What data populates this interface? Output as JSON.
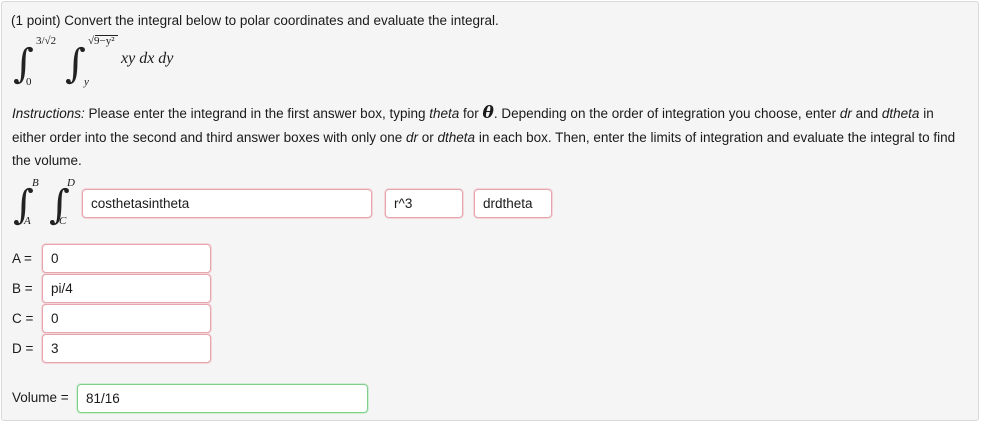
{
  "problem": {
    "header": "(1 point) Convert the integral below to polar coordinates and evaluate the integral.",
    "integral": {
      "outer_upper": "3/√2",
      "outer_lower": "0",
      "inner_upper": "√9−y²",
      "inner_lower": "y",
      "integrand": "xy dx dy"
    }
  },
  "instructions": {
    "label": "Instructions:",
    "part1": " Please enter the integrand in the first answer box, typing ",
    "theta_word": "theta",
    "part2": " for ",
    "theta_symbol": "θ",
    "part3": ". Depending on the order of integration you choose, enter ",
    "dr": "dr",
    "part4": " and ",
    "dtheta": "dtheta",
    "part5": " in either order into the second and third answer boxes with only one ",
    "dr2": "dr",
    "part6": " or ",
    "dtheta2": "dtheta",
    "part7": " in each box. Then, enter the limits of integration and evaluate the integral to find the volume."
  },
  "polar_integral": {
    "outer_upper": "B",
    "outer_lower": "A",
    "inner_upper": "D",
    "inner_lower": "C"
  },
  "answers": {
    "integrand": "costhetasintheta",
    "differential1": "r^3",
    "differential2": "drdtheta",
    "limits": [
      {
        "label": "A =",
        "value": "0"
      },
      {
        "label": "B =",
        "value": "pi/4"
      },
      {
        "label": "C =",
        "value": "0"
      },
      {
        "label": "D =",
        "value": "3"
      }
    ],
    "volume_label": "Volume =",
    "volume": "81/16"
  },
  "colors": {
    "incorrect_border": "#e6a6ae",
    "correct_border": "#7fcf8a",
    "panel_bg": "#f5f5f5"
  }
}
